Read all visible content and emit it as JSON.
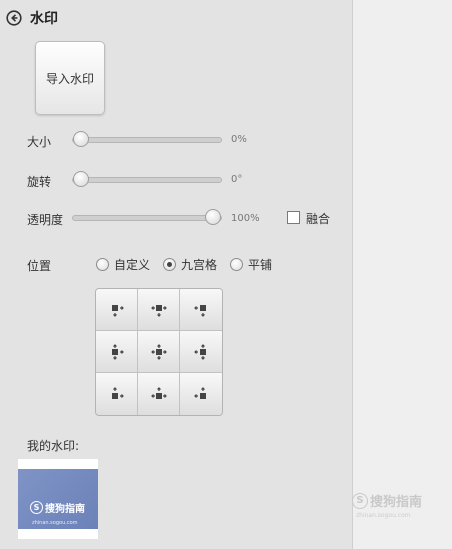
{
  "header": {
    "title": "水印",
    "back_icon": "back-arrow-circle-icon"
  },
  "import_button": {
    "label": "导入水印"
  },
  "sliders": {
    "size": {
      "label": "大小",
      "value_text": "0%",
      "level": 0
    },
    "rotate": {
      "label": "旋转",
      "value_text": "0°",
      "level": 0
    },
    "opacity": {
      "label": "透明度",
      "value_text": "100%",
      "level": 1
    }
  },
  "blend": {
    "label": "融合",
    "checked": false
  },
  "position": {
    "label": "位置",
    "options": [
      "自定义",
      "九宫格",
      "平铺"
    ],
    "selected": "九宫格"
  },
  "grid_cells": [
    "align-top-left-icon",
    "align-top-center-icon",
    "align-top-right-icon",
    "align-middle-left-icon",
    "align-center-icon",
    "align-middle-right-icon",
    "align-bottom-left-icon",
    "align-bottom-center-icon",
    "align-bottom-right-icon"
  ],
  "my_watermarks": {
    "label": "我的水印:",
    "items": [
      {
        "brand": "搜狗指南",
        "url": "zhinan.sogou.com"
      }
    ]
  },
  "corner_watermark": {
    "brand": "搜狗指南",
    "url": "zhinan.sogou.com"
  },
  "colors": {
    "panel": "#e3e3e3",
    "thumbnail_bg": "#7486bd"
  }
}
